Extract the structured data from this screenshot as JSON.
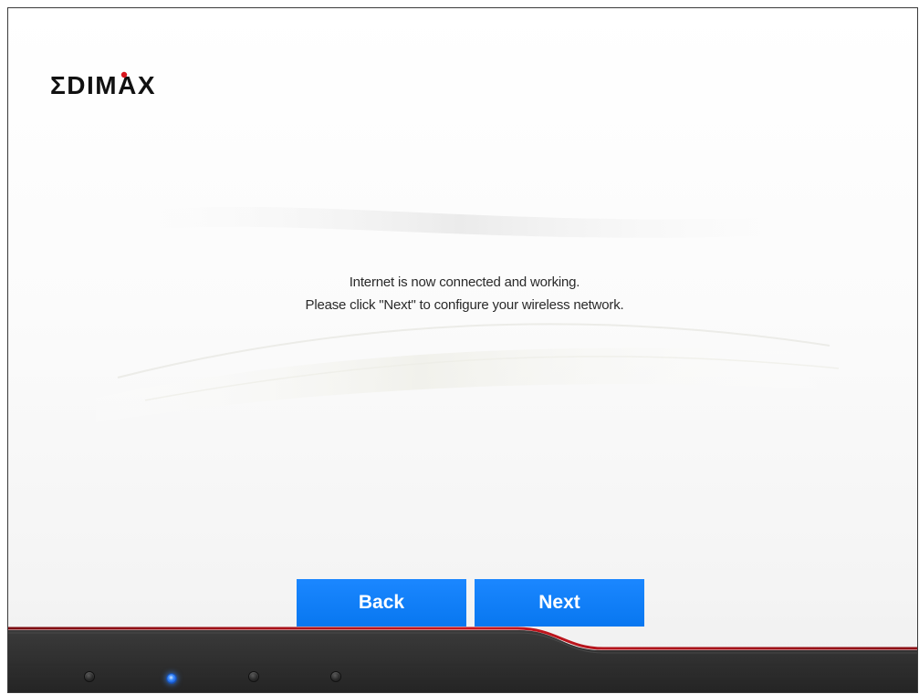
{
  "brand": {
    "name": "EDIMAX",
    "accent_color": "#d8161e"
  },
  "message": {
    "line1": "Internet is now connected and working.",
    "line2": "Please click \"Next\" to configure your wireless network."
  },
  "buttons": {
    "back_label": "Back",
    "next_label": "Next",
    "color": "#0f7ef7"
  },
  "progress": {
    "total_steps": 4,
    "current_step": 2,
    "active_color": "#3d8dff"
  },
  "footer": {
    "bar_color": "#2f2f2f",
    "stripe_color": "#b3141c"
  }
}
